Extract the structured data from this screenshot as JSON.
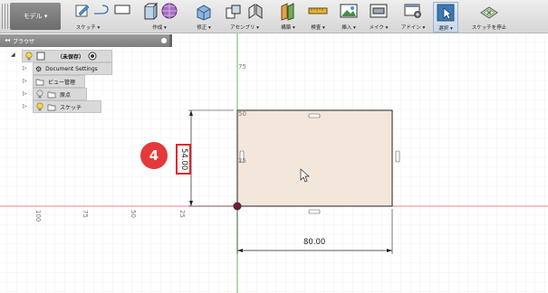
{
  "toolbar": {
    "workspace": "モデル ▾",
    "groups": [
      {
        "id": "sketch",
        "label": "スケッチ ▾"
      },
      {
        "id": "create",
        "label": "作成 ▾"
      },
      {
        "id": "modify",
        "label": "修正 ▾"
      },
      {
        "id": "assemble",
        "label": "アセンブリ ▾"
      },
      {
        "id": "construct",
        "label": "構築 ▾"
      },
      {
        "id": "inspect",
        "label": "検査 ▾"
      },
      {
        "id": "insert",
        "label": "挿入 ▾"
      },
      {
        "id": "make",
        "label": "メイク ▾"
      },
      {
        "id": "addins",
        "label": "アドイン ▾"
      },
      {
        "id": "select",
        "label": "選択 ▾"
      },
      {
        "id": "stop_sketch",
        "label": "スケッチを停止"
      }
    ]
  },
  "browser": {
    "title": "ブラウザ",
    "root": "（未保存）",
    "items": [
      {
        "label": "Document Settings",
        "icon": "gear-icon"
      },
      {
        "label": "ビュー管理",
        "icon": "folder-icon"
      },
      {
        "label": "原点",
        "icon": "folder-icon"
      },
      {
        "label": "スケッチ",
        "icon": "folder-icon"
      }
    ]
  },
  "canvas": {
    "dimension_height": "54.00",
    "dimension_width": "80.00",
    "callout_number": "4",
    "axis_labels": {
      "v75": "75",
      "v50": "50",
      "v25": "25",
      "h100": "100",
      "h75": "75",
      "h50": "50",
      "h25": "25"
    },
    "colors": {
      "sketch_fill": "#f3e6da",
      "grid": "#e3e6ea",
      "axis_red": "#e88a8a",
      "axis_green": "#5bbf5b",
      "callout": "#e5393b"
    }
  }
}
